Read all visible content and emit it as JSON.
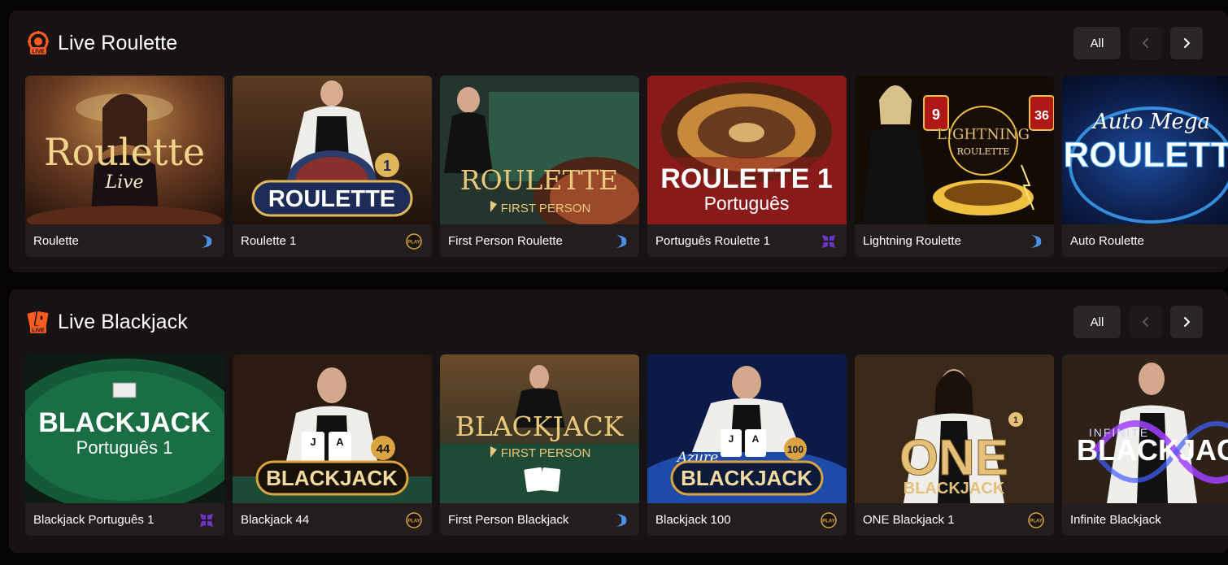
{
  "sections": [
    {
      "title": "Live Roulette",
      "icon": "live-roulette-icon",
      "all_label": "All",
      "prev_icon": "chevron-left-icon",
      "next_icon": "chevron-right-icon",
      "cards": [
        {
          "name": "Roulette",
          "provider_icon": "evolution-provider-icon",
          "thumb_title": "Roulette",
          "thumb_subtitle": "Live"
        },
        {
          "name": "Roulette 1",
          "provider_icon": "playtech-provider-icon",
          "thumb_title": "ROULETTE",
          "thumb_badge": "1"
        },
        {
          "name": "First Person Roulette",
          "provider_icon": "evolution-provider-icon",
          "thumb_title": "ROULETTE",
          "thumb_subtitle": "FIRST PERSON"
        },
        {
          "name": "Português Roulette 1",
          "provider_icon": "pragmatic-provider-icon",
          "thumb_title": "ROULETTE 1",
          "thumb_subtitle": "Português"
        },
        {
          "name": "Lightning Roulette",
          "provider_icon": "evolution-provider-icon",
          "thumb_title": "LIGHTNING",
          "thumb_subtitle": "ROULETTE",
          "thumb_num_a": "9",
          "thumb_num_b": "36"
        },
        {
          "name": "Auto Roulette",
          "provider_icon": "",
          "thumb_title": "ROULETTE",
          "thumb_subtitle": "Auto Mega"
        }
      ]
    },
    {
      "title": "Live Blackjack",
      "icon": "live-blackjack-icon",
      "all_label": "All",
      "prev_icon": "chevron-left-icon",
      "next_icon": "chevron-right-icon",
      "cards": [
        {
          "name": "Blackjack Português 1",
          "provider_icon": "pragmatic-provider-icon",
          "thumb_title": "BLACKJACK",
          "thumb_subtitle": "Português 1"
        },
        {
          "name": "Blackjack 44",
          "provider_icon": "playtech-provider-icon",
          "thumb_title": "BLACKJACK",
          "thumb_badge": "44"
        },
        {
          "name": "First Person Blackjack",
          "provider_icon": "evolution-provider-icon",
          "thumb_title": "BLACKJACK",
          "thumb_subtitle": "FIRST PERSON"
        },
        {
          "name": "Blackjack 100",
          "provider_icon": "playtech-provider-icon",
          "thumb_title": "BLACKJACK",
          "thumb_subtitle": "Azure",
          "thumb_badge": "100"
        },
        {
          "name": "ONE Blackjack 1",
          "provider_icon": "playtech-provider-icon",
          "thumb_title": "ONE",
          "thumb_subtitle": "BLACKJACK",
          "thumb_badge": "1"
        },
        {
          "name": "Infinite Blackjack",
          "provider_icon": "",
          "thumb_title": "BLACKJACK",
          "thumb_subtitle": "INFINITE"
        }
      ]
    }
  ],
  "provider_badge_text": "PLAY",
  "live_badge_text": "LIVE",
  "colors": {
    "section_bg": "#171213",
    "card_bg": "#231d1e",
    "accent_orange": "#ff5a1f",
    "evolution_blue": "#4a90e2",
    "pragmatic_purple": "#6a35c9",
    "playtech_gold": "#d9a441"
  }
}
